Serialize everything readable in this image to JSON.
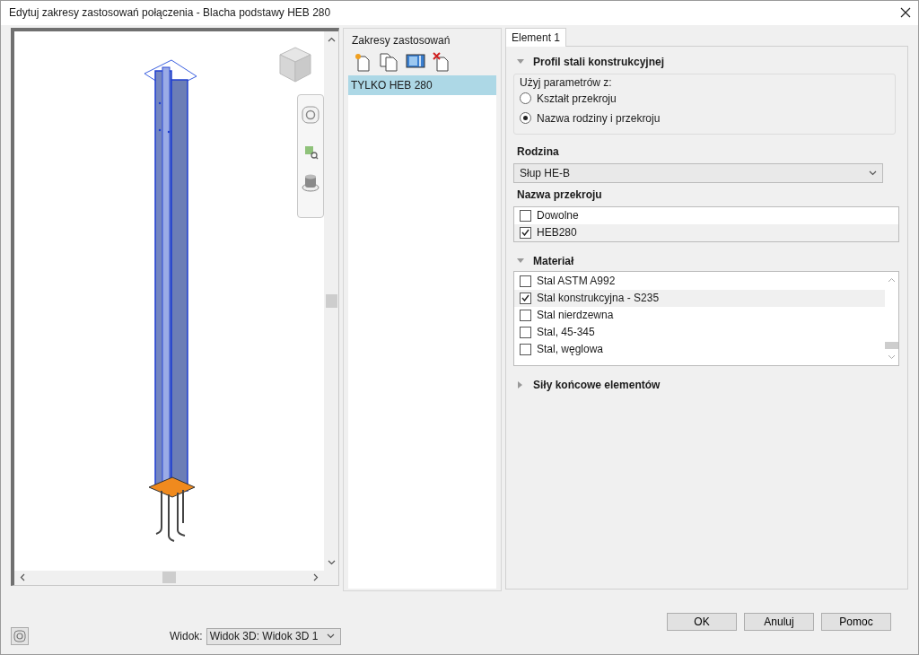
{
  "window": {
    "title": "Edytuj zakresy zastosowań połączenia - Blacha podstawy HEB 280"
  },
  "viewport": {
    "view_label": "Widok:",
    "view_value": "Widok 3D: Widok 3D 1"
  },
  "scopes": {
    "title": "Zakresy zastosowań",
    "items": [
      {
        "label": "TYLKO HEB 280",
        "selected": true
      }
    ]
  },
  "tabs": [
    {
      "label": "Element 1",
      "selected": true
    }
  ],
  "profile": {
    "title": "Profil stali konstrukcyjnej",
    "expanded": true,
    "group_label": "Użyj parametrów z:",
    "options": [
      {
        "label": "Kształt przekroju",
        "selected": false
      },
      {
        "label": "Nazwa rodziny i przekroju",
        "selected": true
      }
    ],
    "family_label": "Rodzina",
    "family_value": "Słup HE-B",
    "section_label": "Nazwa przekroju",
    "sections": [
      {
        "label": "Dowolne",
        "checked": false
      },
      {
        "label": "HEB280",
        "checked": true
      }
    ]
  },
  "material": {
    "title": "Materiał",
    "expanded": true,
    "items": [
      {
        "label": "Stal ASTM A992",
        "checked": false
      },
      {
        "label": "Stal konstrukcyjna - S235",
        "checked": true
      },
      {
        "label": "Stal nierdzewna",
        "checked": false
      },
      {
        "label": "Stal, 45-345",
        "checked": false
      },
      {
        "label": "Stal, węglowa",
        "checked": false
      }
    ]
  },
  "forces": {
    "title": "Siły końcowe elementów",
    "expanded": false
  },
  "buttons": [
    "OK",
    "Anuluj",
    "Pomoc"
  ]
}
